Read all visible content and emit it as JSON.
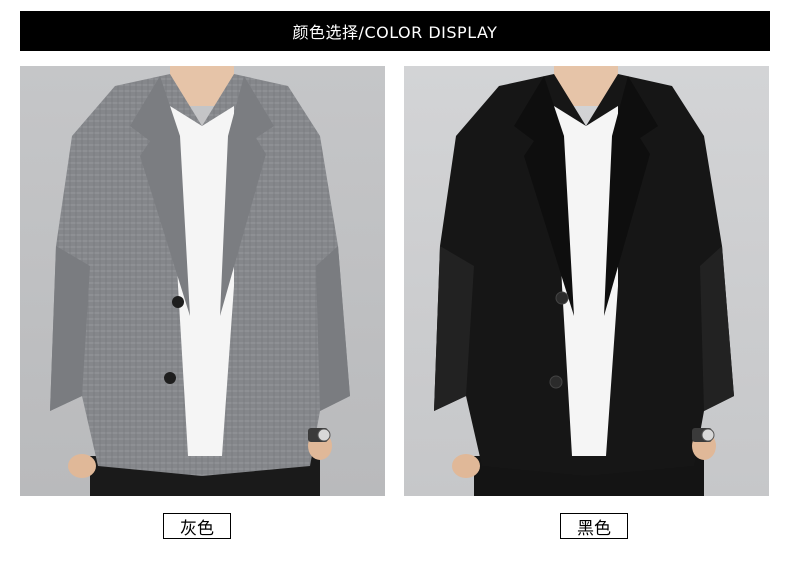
{
  "header": {
    "title": "颜色选择/COLOR DISPLAY"
  },
  "colors": [
    {
      "label": "灰色",
      "jacket_hex": "#8a8c90"
    },
    {
      "label": "黑色",
      "jacket_hex": "#151515"
    }
  ]
}
